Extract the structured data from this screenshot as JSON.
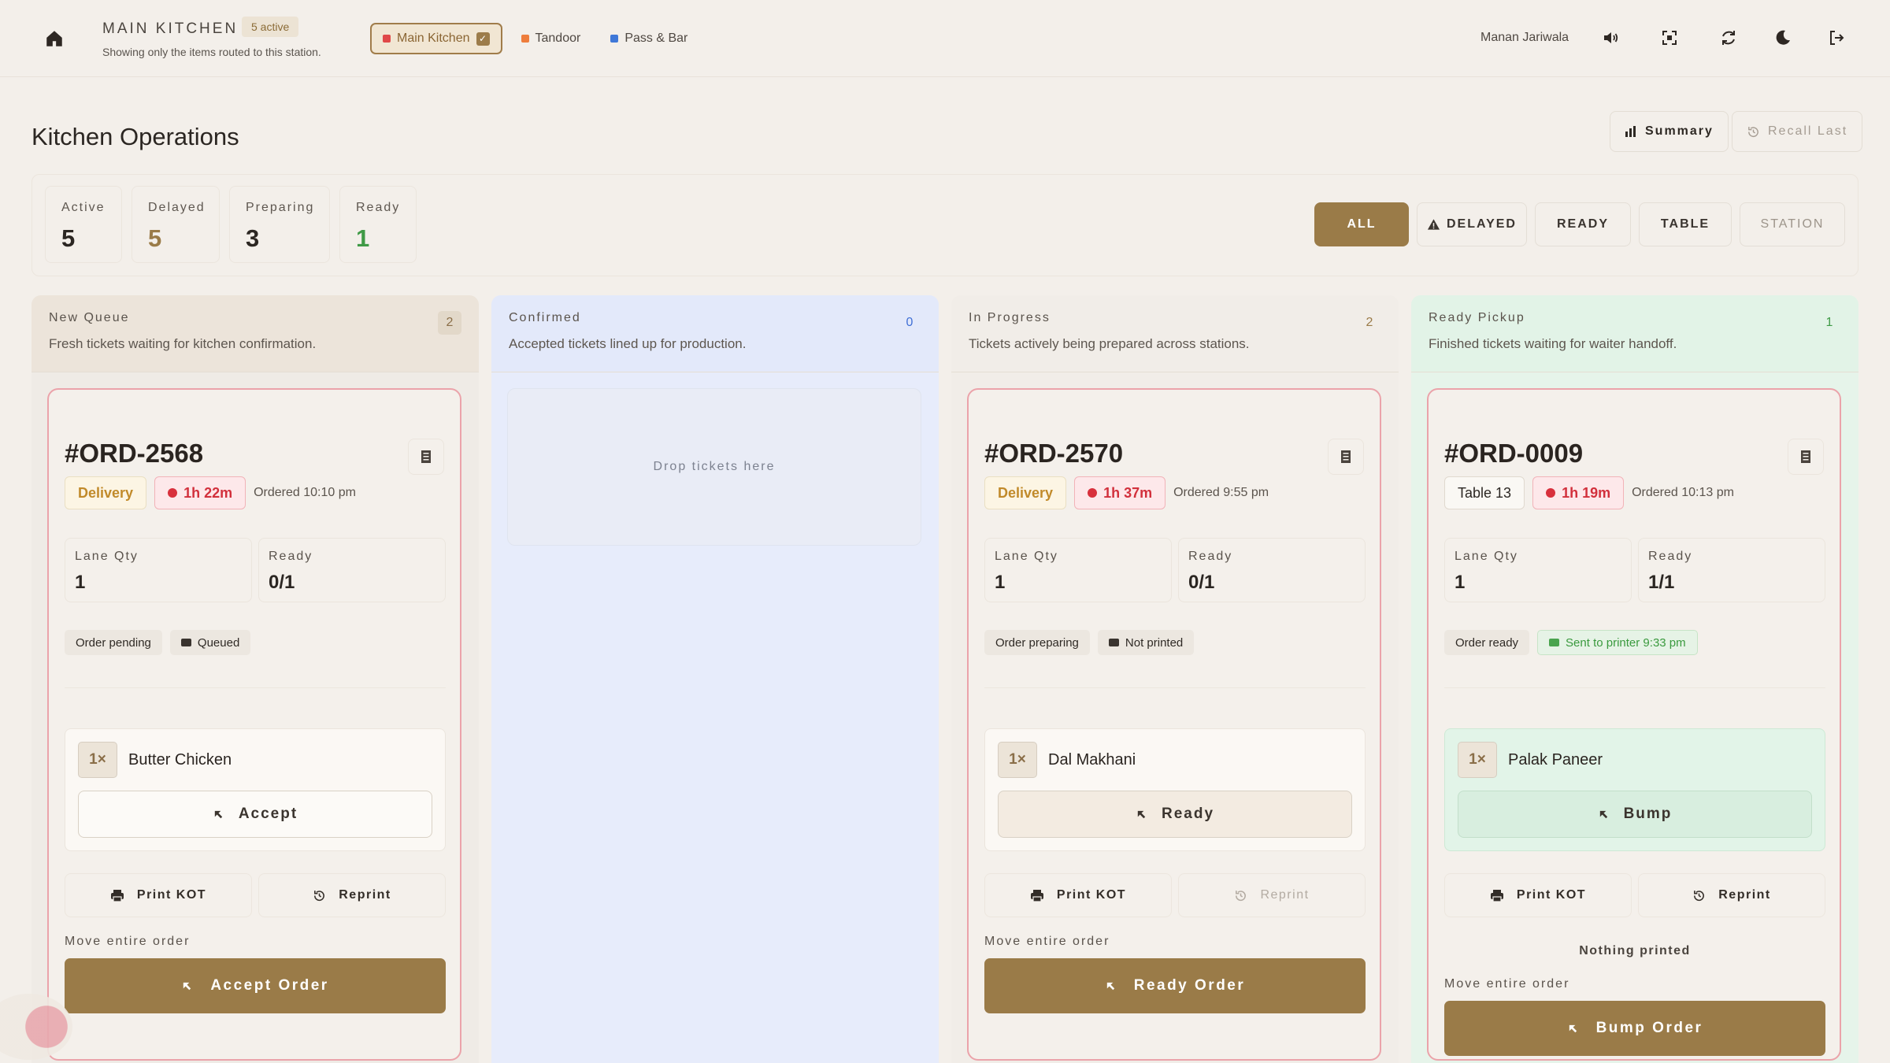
{
  "header": {
    "station_title": "MAIN KITCHEN",
    "active_badge": "5 active",
    "subtitle": "Showing only the items routed to this station.",
    "stations": [
      {
        "label": "Main Kitchen",
        "color": "#e04848",
        "active": true
      },
      {
        "label": "Tandoor",
        "color": "#ee7d3c",
        "active": false
      },
      {
        "label": "Pass & Bar",
        "color": "#3f78d8",
        "active": false
      }
    ],
    "user_name": "Manan Jariwala",
    "icons": [
      "volume-icon",
      "fullscreen-icon",
      "refresh-icon",
      "moon-icon",
      "logout-icon"
    ]
  },
  "page": {
    "title": "Kitchen Operations",
    "summary_label": "Summary",
    "recall_label": "Recall Last"
  },
  "stats": [
    {
      "label": "Active",
      "value": "5",
      "color": "#2b2622"
    },
    {
      "label": "Delayed",
      "value": "5",
      "color": "#9a7b48"
    },
    {
      "label": "Preparing",
      "value": "3",
      "color": "#2b2622"
    },
    {
      "label": "Ready",
      "value": "1",
      "color": "#3f9a46"
    }
  ],
  "filters": [
    {
      "label": "ALL",
      "state": "on"
    },
    {
      "label": "DELAYED",
      "state": "normal"
    },
    {
      "label": "READY",
      "state": "normal"
    },
    {
      "label": "TABLE",
      "state": "normal"
    },
    {
      "label": "STATION",
      "state": "dim"
    }
  ],
  "columns": [
    {
      "title": "New Queue",
      "description": "Fresh tickets waiting for kitchen confirmation.",
      "count": "2",
      "card": {
        "id": "#ORD-2568",
        "type_tag": "Delivery",
        "timer": "1h 22m",
        "ordered": "Ordered 10:10 pm",
        "lane_qty_label": "Lane Qty",
        "lane_qty": "1",
        "ready_label": "Ready",
        "ready": "0/1",
        "status_chip": "Order pending",
        "print_chip": "Queued",
        "item_qty": "1×",
        "item_name": "Butter Chicken",
        "item_action": "Accept",
        "print_label": "Print KOT",
        "reprint_label": "Reprint",
        "move_label": "Move entire order",
        "order_action": "Accept Order"
      }
    },
    {
      "title": "Confirmed",
      "description": "Accepted tickets lined up for production.",
      "count": "0",
      "drop_text": "Drop tickets here"
    },
    {
      "title": "In Progress",
      "description": "Tickets actively being prepared across stations.",
      "count": "2",
      "card": {
        "id": "#ORD-2570",
        "type_tag": "Delivery",
        "timer": "1h 37m",
        "ordered": "Ordered 9:55 pm",
        "lane_qty_label": "Lane Qty",
        "lane_qty": "1",
        "ready_label": "Ready",
        "ready": "0/1",
        "status_chip": "Order preparing",
        "print_chip": "Not printed",
        "item_qty": "1×",
        "item_name": "Dal Makhani",
        "item_action": "Ready",
        "print_label": "Print KOT",
        "reprint_label": "Reprint",
        "move_label": "Move entire order",
        "order_action": "Ready Order"
      }
    },
    {
      "title": "Ready Pickup",
      "description": "Finished tickets waiting for waiter handoff.",
      "count": "1",
      "card": {
        "id": "#ORD-0009",
        "type_tag": "Table 13",
        "timer": "1h 19m",
        "ordered": "Ordered 10:13 pm",
        "lane_qty_label": "Lane Qty",
        "lane_qty": "1",
        "ready_label": "Ready",
        "ready": "1/1",
        "status_chip": "Order ready",
        "print_chip": "Sent to printer 9:33 pm",
        "item_qty": "1×",
        "item_name": "Palak Paneer",
        "item_action": "Bump",
        "print_label": "Print KOT",
        "reprint_label": "Reprint",
        "nothing_printed": "Nothing printed",
        "move_label": "Move entire order",
        "order_action": "Bump Order"
      }
    }
  ]
}
